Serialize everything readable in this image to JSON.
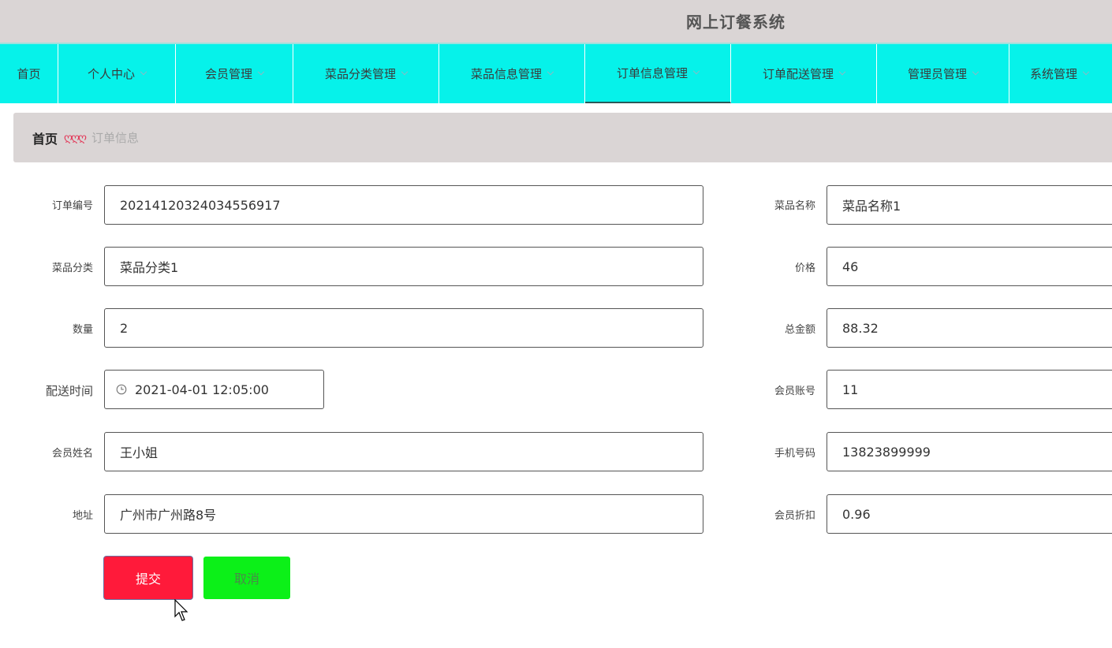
{
  "header": {
    "title": "网上订餐系统"
  },
  "nav": {
    "items": [
      {
        "label": "首页"
      },
      {
        "label": "个人中心"
      },
      {
        "label": "会员管理"
      },
      {
        "label": "菜品分类管理"
      },
      {
        "label": "菜品信息管理"
      },
      {
        "label": "订单信息管理"
      },
      {
        "label": "订单配送管理"
      },
      {
        "label": "管理员管理"
      },
      {
        "label": "系统管理"
      }
    ],
    "active_index": 5
  },
  "breadcrumb": {
    "home": "首页",
    "separator": "ღღღ",
    "current": "订单信息"
  },
  "form": {
    "order_no": {
      "label": "订单编号",
      "value": "20214120324034556917"
    },
    "dish_category": {
      "label": "菜品分类",
      "value": "菜品分类1"
    },
    "quantity": {
      "label": "数量",
      "value": "2"
    },
    "delivery_time": {
      "label": "配送时间",
      "value": "2021-04-01 12:05:00"
    },
    "member_name": {
      "label": "会员姓名",
      "value": "王小姐"
    },
    "address": {
      "label": "地址",
      "value": "广州市广州路8号"
    },
    "dish_name": {
      "label": "菜品名称",
      "value": "菜品名称1"
    },
    "price": {
      "label": "价格",
      "value": "46"
    },
    "total": {
      "label": "总金额",
      "value": "88.32"
    },
    "member_account": {
      "label": "会员账号",
      "value": "11"
    },
    "phone": {
      "label": "手机号码",
      "value": "13823899999"
    },
    "discount": {
      "label": "会员折扣",
      "value": "0.96"
    }
  },
  "buttons": {
    "submit": "提交",
    "cancel": "取消"
  },
  "colors": {
    "nav_bg": "#06f2ea",
    "header_bg": "#dad5d5",
    "submit_bg": "#ff1a3a",
    "cancel_bg": "#0cf018"
  }
}
